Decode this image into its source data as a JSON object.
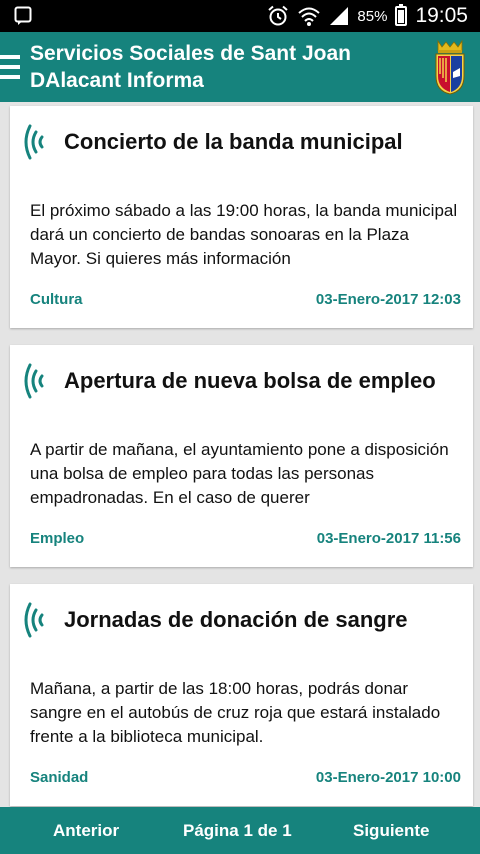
{
  "status": {
    "battery": "85%",
    "time": "19:05"
  },
  "app": {
    "title": "Servicios Sociales de Sant Joan DAlacant Informa",
    "accent_color": "#16837d"
  },
  "news": [
    {
      "title": "Concierto de la banda municipal",
      "body": "El próximo sábado a las 19:00 horas, la banda municipal dará un concierto de bandas sonoaras en la Plaza Mayor. Si quieres más información",
      "category": "Cultura",
      "date": "03-Enero-2017 12:03"
    },
    {
      "title": "Apertura de nueva bolsa de empleo",
      "body": "A partir de mañana, el ayuntamiento pone a disposición una bolsa de empleo para todas las personas empadronadas. En el caso de querer",
      "category": "Empleo",
      "date": "03-Enero-2017 11:56"
    },
    {
      "title": "Jornadas de donación de sangre",
      "body": "Mañana, a partir de las 18:00 horas, podrás donar sangre en el autobús de cruz roja que estará instalado frente a la biblioteca municipal.",
      "category": "Sanidad",
      "date": "03-Enero-2017 10:00"
    }
  ],
  "pagination": {
    "prev_label": "Anterior",
    "page_label": "Página 1 de 1",
    "next_label": "Siguiente"
  }
}
